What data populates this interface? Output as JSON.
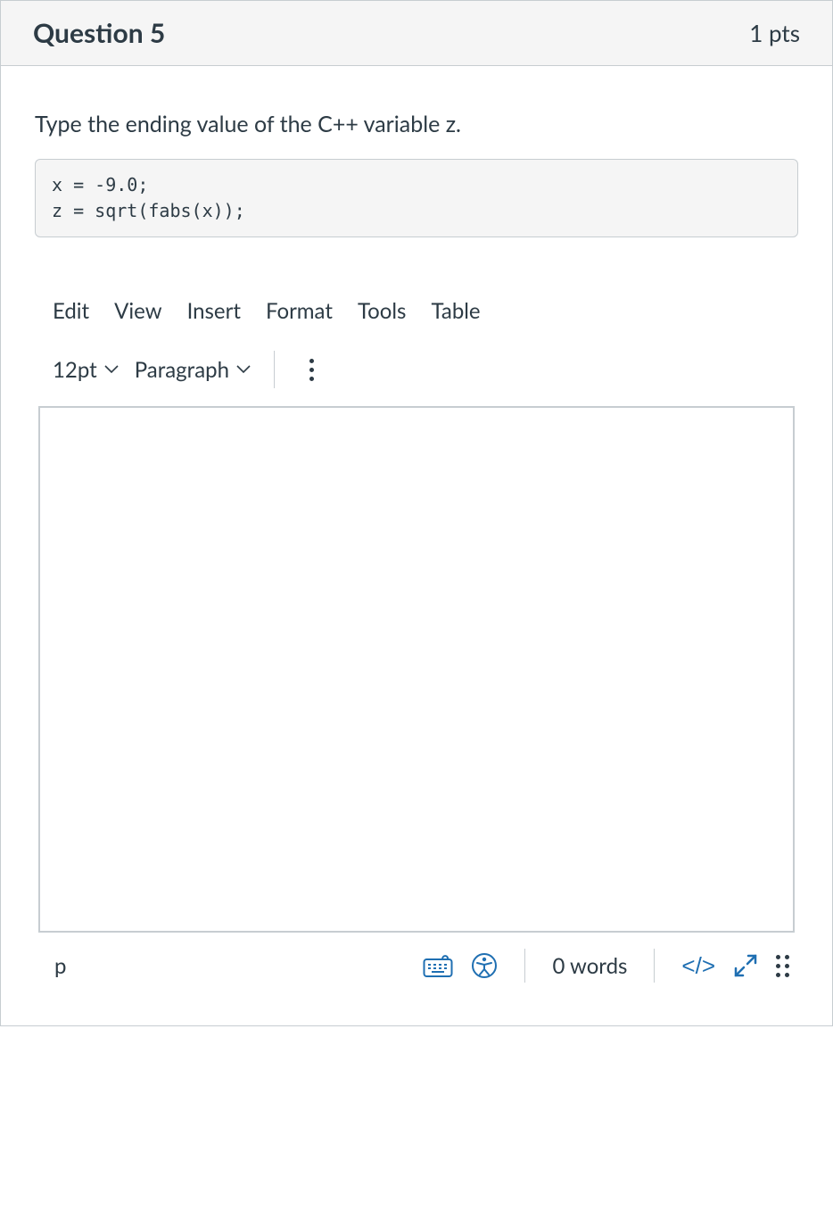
{
  "header": {
    "title": "Question 5",
    "points": "1 pts"
  },
  "prompt": "Type the ending value of the C++ variable z.",
  "code": "x = -9.0;\nz = sqrt(fabs(x));",
  "editor": {
    "menubar": {
      "edit": "Edit",
      "view": "View",
      "insert": "Insert",
      "format": "Format",
      "tools": "Tools",
      "table": "Table"
    },
    "toolbar": {
      "font_size": "12pt",
      "block_format": "Paragraph"
    },
    "statusbar": {
      "path": "p",
      "word_count": "0 words",
      "html_view": "</>"
    }
  }
}
